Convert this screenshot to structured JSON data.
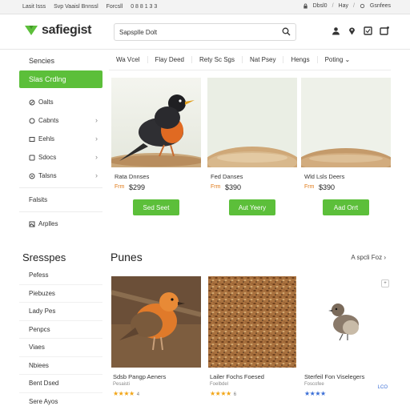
{
  "topbar": {
    "links": [
      "Lasit Isss",
      "Svp Vaaisl Bnnssl",
      "Forcsll",
      "0 8 8 1 3 3"
    ],
    "right_items": [
      "Dbsl0",
      "Hay",
      "Gsnfees"
    ]
  },
  "header": {
    "brand": "safiegist",
    "search": {
      "value": "Sapsplle Dolt",
      "placeholder": "Sapsplle Dolt"
    },
    "icons": [
      "user-icon",
      "location-icon",
      "orders-icon",
      "cart-icon"
    ]
  },
  "sidebar": {
    "title": "Sencies",
    "active": "Slas Crdlng",
    "items": [
      {
        "label": "Oalts",
        "icon": "leaf-icon",
        "chevron": false
      },
      {
        "label": "Cabnts",
        "icon": "seed-icon",
        "chevron": true
      },
      {
        "label": "Eehls",
        "icon": "bowl-icon",
        "chevron": true
      },
      {
        "label": "Sdocs",
        "icon": "box-icon",
        "chevron": true
      },
      {
        "label": "Talsns",
        "icon": "tag-icon",
        "chevron": true
      },
      {
        "label": "Falsits",
        "icon": "",
        "chevron": false
      },
      {
        "label": "Arplles",
        "icon": "image-icon",
        "chevron": false
      }
    ]
  },
  "catnav": {
    "items": [
      "Wa Vcel",
      "Flay Deed",
      "Rety Sc Sgs",
      "Nat Psey",
      "Hengs",
      "Poting"
    ],
    "last_has_dropdown": true
  },
  "products_row1": [
    {
      "name": "Rata Dnnses",
      "price_label": "Frm",
      "price": "$299",
      "button": "Sed Seet"
    },
    {
      "name": "Fed Danses",
      "price_label": "Frm",
      "price": "$390",
      "button": "Aut Yeery"
    },
    {
      "name": "Wld Lsls Deers",
      "price_label": "Frm",
      "price": "$390",
      "button": "Aad Orrt"
    }
  ],
  "section2": {
    "left_title": "Sresspes",
    "left_items": [
      "Pefess",
      "Piebuzes",
      "Lady Pes",
      "Penpcs",
      "Viaes",
      "Nbiees",
      "Bent Dsed",
      "Sere Ayos"
    ],
    "main_title": "Punes",
    "see_all": "A spcli Foz",
    "products": [
      {
        "name": "Sdsb Pangp Aeners",
        "sub": "Pesaisti",
        "stars": "★★★★",
        "rating": "4",
        "star_color": "orange"
      },
      {
        "name": "Lailer Fochs Foesed",
        "sub": "Foelbdel",
        "stars": "★★★★",
        "rating": "6",
        "star_color": "orange"
      },
      {
        "name": "Sterfeil Fon Viselegers",
        "sub": "Foscofee",
        "stars": "★★★★",
        "rating": "",
        "star_color": "blue",
        "badge": "LCO"
      }
    ]
  },
  "colors": {
    "accent_green": "#5cbf3a",
    "price_orange": "#e07b1a",
    "star_orange": "#f2a516",
    "star_blue": "#3a6ed6"
  }
}
